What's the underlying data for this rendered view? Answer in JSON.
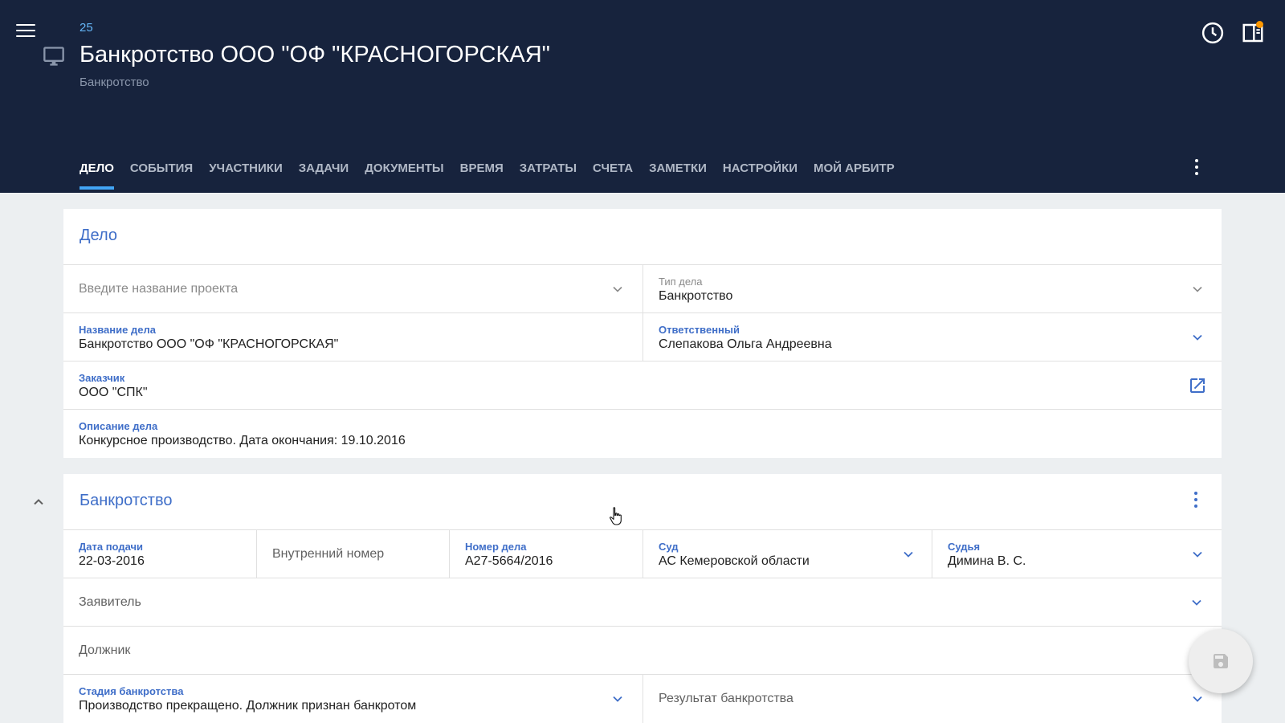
{
  "header": {
    "case_number": "25",
    "title": "Банкротство ООО \"ОФ \"КРАСНОГОРСКАЯ\"",
    "subtitle": "Банкротство",
    "notification_color": "#ff9800",
    "icons": [
      "menu-icon",
      "monitor-icon",
      "history-clock-icon",
      "side-panel-icon",
      "more-vert-icon"
    ]
  },
  "tabs": [
    {
      "label": "ДЕЛО",
      "active": true
    },
    {
      "label": "СОБЫТИЯ"
    },
    {
      "label": "УЧАСТНИКИ"
    },
    {
      "label": "ЗАДАЧИ"
    },
    {
      "label": "ДОКУМЕНТЫ"
    },
    {
      "label": "ВРЕМЯ"
    },
    {
      "label": "ЗАТРАТЫ"
    },
    {
      "label": "СЧЕТА"
    },
    {
      "label": "ЗАМЕТКИ"
    },
    {
      "label": "НАСТРОЙКИ"
    },
    {
      "label": "МОЙ АРБИТР"
    }
  ],
  "case_card": {
    "title": "Дело",
    "project": {
      "placeholder": "Введите название проекта"
    },
    "case_type": {
      "label": "Тип дела",
      "value": "Банкротство"
    },
    "case_name": {
      "label": "Название дела",
      "value": "Банкротство ООО \"ОФ \"КРАСНОГОРСКАЯ\""
    },
    "responsible": {
      "label": "Ответственный",
      "value": "Слепакова Ольга Андреевна"
    },
    "client": {
      "label": "Заказчик",
      "value": "ООО \"СПК\""
    },
    "description": {
      "label": "Описание дела",
      "value": "Конкурсное производство. Дата окончания: 19.10.2016"
    }
  },
  "bankruptcy_card": {
    "title": "Банкротство",
    "filing_date": {
      "label": "Дата подачи",
      "value": "22-03-2016"
    },
    "internal_number": {
      "placeholder": "Внутренний номер"
    },
    "case_number": {
      "label": "Номер дела",
      "value": "А27-5664/2016"
    },
    "court": {
      "label": "Суд",
      "value": "АС Кемеровской области"
    },
    "judge": {
      "label": "Судья",
      "value": "Димина В. С."
    },
    "applicant": {
      "placeholder": "Заявитель"
    },
    "debtor": {
      "placeholder": "Должник"
    },
    "stage": {
      "label": "Стадия банкротства",
      "value": "Производство прекращено. Должник признан банкротом"
    },
    "result": {
      "placeholder": "Результат банкротства"
    }
  },
  "colors": {
    "header_bg": "#17233d",
    "accent": "#3f6ec8",
    "tab_indicator": "#42a5f5",
    "page_bg": "#eceff1"
  }
}
